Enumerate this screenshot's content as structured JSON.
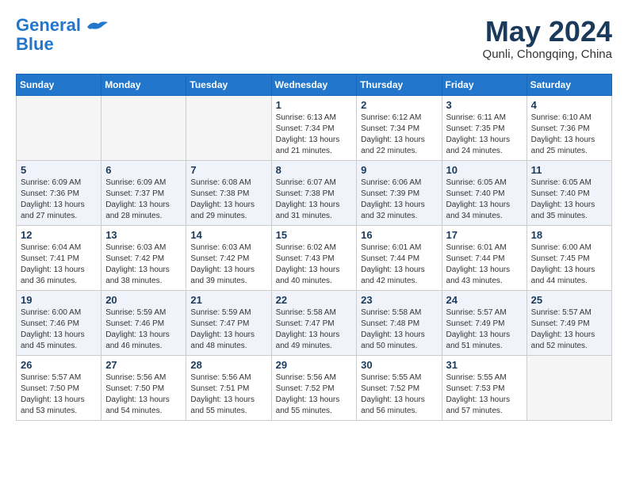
{
  "header": {
    "logo_line1": "General",
    "logo_line2": "Blue",
    "month": "May 2024",
    "location": "Qunli, Chongqing, China"
  },
  "weekdays": [
    "Sunday",
    "Monday",
    "Tuesday",
    "Wednesday",
    "Thursday",
    "Friday",
    "Saturday"
  ],
  "weeks": [
    [
      {
        "day": "",
        "info": ""
      },
      {
        "day": "",
        "info": ""
      },
      {
        "day": "",
        "info": ""
      },
      {
        "day": "1",
        "info": "Sunrise: 6:13 AM\nSunset: 7:34 PM\nDaylight: 13 hours\nand 21 minutes."
      },
      {
        "day": "2",
        "info": "Sunrise: 6:12 AM\nSunset: 7:34 PM\nDaylight: 13 hours\nand 22 minutes."
      },
      {
        "day": "3",
        "info": "Sunrise: 6:11 AM\nSunset: 7:35 PM\nDaylight: 13 hours\nand 24 minutes."
      },
      {
        "day": "4",
        "info": "Sunrise: 6:10 AM\nSunset: 7:36 PM\nDaylight: 13 hours\nand 25 minutes."
      }
    ],
    [
      {
        "day": "5",
        "info": "Sunrise: 6:09 AM\nSunset: 7:36 PM\nDaylight: 13 hours\nand 27 minutes."
      },
      {
        "day": "6",
        "info": "Sunrise: 6:09 AM\nSunset: 7:37 PM\nDaylight: 13 hours\nand 28 minutes."
      },
      {
        "day": "7",
        "info": "Sunrise: 6:08 AM\nSunset: 7:38 PM\nDaylight: 13 hours\nand 29 minutes."
      },
      {
        "day": "8",
        "info": "Sunrise: 6:07 AM\nSunset: 7:38 PM\nDaylight: 13 hours\nand 31 minutes."
      },
      {
        "day": "9",
        "info": "Sunrise: 6:06 AM\nSunset: 7:39 PM\nDaylight: 13 hours\nand 32 minutes."
      },
      {
        "day": "10",
        "info": "Sunrise: 6:05 AM\nSunset: 7:40 PM\nDaylight: 13 hours\nand 34 minutes."
      },
      {
        "day": "11",
        "info": "Sunrise: 6:05 AM\nSunset: 7:40 PM\nDaylight: 13 hours\nand 35 minutes."
      }
    ],
    [
      {
        "day": "12",
        "info": "Sunrise: 6:04 AM\nSunset: 7:41 PM\nDaylight: 13 hours\nand 36 minutes."
      },
      {
        "day": "13",
        "info": "Sunrise: 6:03 AM\nSunset: 7:42 PM\nDaylight: 13 hours\nand 38 minutes."
      },
      {
        "day": "14",
        "info": "Sunrise: 6:03 AM\nSunset: 7:42 PM\nDaylight: 13 hours\nand 39 minutes."
      },
      {
        "day": "15",
        "info": "Sunrise: 6:02 AM\nSunset: 7:43 PM\nDaylight: 13 hours\nand 40 minutes."
      },
      {
        "day": "16",
        "info": "Sunrise: 6:01 AM\nSunset: 7:44 PM\nDaylight: 13 hours\nand 42 minutes."
      },
      {
        "day": "17",
        "info": "Sunrise: 6:01 AM\nSunset: 7:44 PM\nDaylight: 13 hours\nand 43 minutes."
      },
      {
        "day": "18",
        "info": "Sunrise: 6:00 AM\nSunset: 7:45 PM\nDaylight: 13 hours\nand 44 minutes."
      }
    ],
    [
      {
        "day": "19",
        "info": "Sunrise: 6:00 AM\nSunset: 7:46 PM\nDaylight: 13 hours\nand 45 minutes."
      },
      {
        "day": "20",
        "info": "Sunrise: 5:59 AM\nSunset: 7:46 PM\nDaylight: 13 hours\nand 46 minutes."
      },
      {
        "day": "21",
        "info": "Sunrise: 5:59 AM\nSunset: 7:47 PM\nDaylight: 13 hours\nand 48 minutes."
      },
      {
        "day": "22",
        "info": "Sunrise: 5:58 AM\nSunset: 7:47 PM\nDaylight: 13 hours\nand 49 minutes."
      },
      {
        "day": "23",
        "info": "Sunrise: 5:58 AM\nSunset: 7:48 PM\nDaylight: 13 hours\nand 50 minutes."
      },
      {
        "day": "24",
        "info": "Sunrise: 5:57 AM\nSunset: 7:49 PM\nDaylight: 13 hours\nand 51 minutes."
      },
      {
        "day": "25",
        "info": "Sunrise: 5:57 AM\nSunset: 7:49 PM\nDaylight: 13 hours\nand 52 minutes."
      }
    ],
    [
      {
        "day": "26",
        "info": "Sunrise: 5:57 AM\nSunset: 7:50 PM\nDaylight: 13 hours\nand 53 minutes."
      },
      {
        "day": "27",
        "info": "Sunrise: 5:56 AM\nSunset: 7:50 PM\nDaylight: 13 hours\nand 54 minutes."
      },
      {
        "day": "28",
        "info": "Sunrise: 5:56 AM\nSunset: 7:51 PM\nDaylight: 13 hours\nand 55 minutes."
      },
      {
        "day": "29",
        "info": "Sunrise: 5:56 AM\nSunset: 7:52 PM\nDaylight: 13 hours\nand 55 minutes."
      },
      {
        "day": "30",
        "info": "Sunrise: 5:55 AM\nSunset: 7:52 PM\nDaylight: 13 hours\nand 56 minutes."
      },
      {
        "day": "31",
        "info": "Sunrise: 5:55 AM\nSunset: 7:53 PM\nDaylight: 13 hours\nand 57 minutes."
      },
      {
        "day": "",
        "info": ""
      }
    ]
  ]
}
